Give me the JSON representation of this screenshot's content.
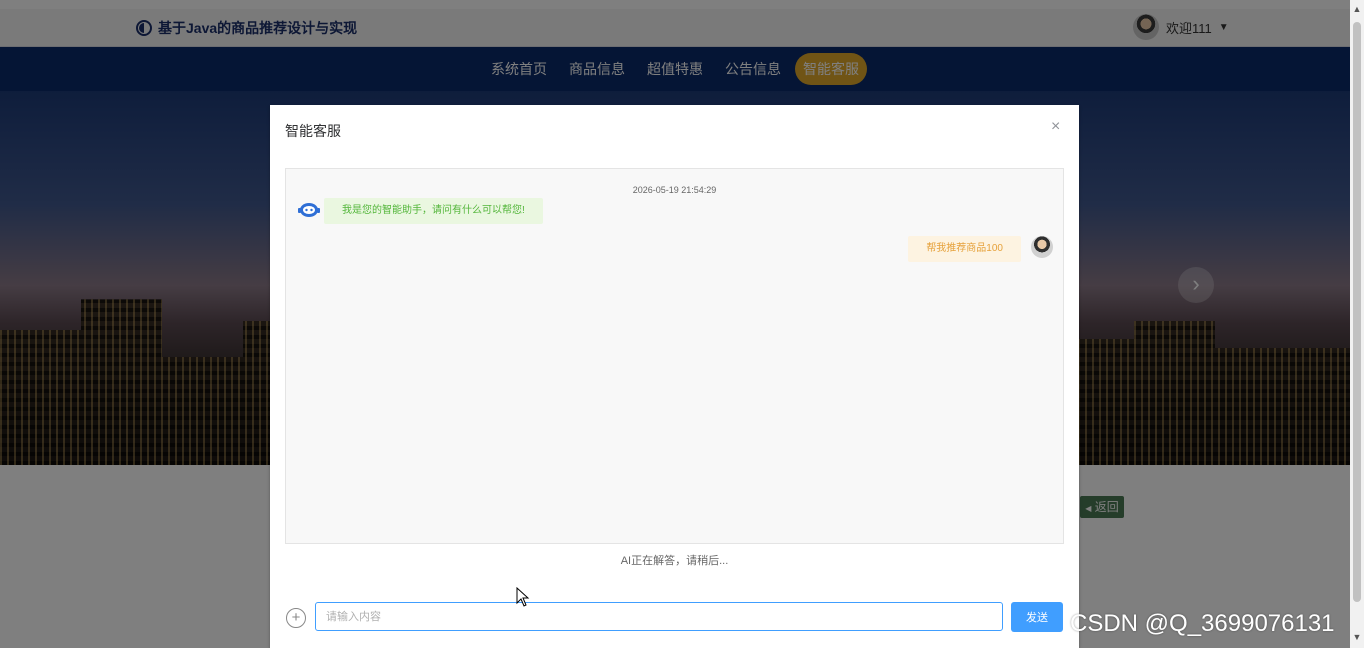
{
  "header": {
    "site_title": "基于Java的商品推荐设计与实现",
    "user_greeting": "欢迎111",
    "dropdown_caret": "▼"
  },
  "nav": {
    "items": [
      "系统首页",
      "商品信息",
      "超值特惠",
      "公告信息",
      "智能客服"
    ],
    "active_index": 4
  },
  "banner": {
    "next_arrow": "›"
  },
  "page": {
    "back_label": "返回"
  },
  "dialog": {
    "title": "智能客服",
    "close": "×",
    "timestamp": "2026-05-19 21:54:29",
    "messages": [
      {
        "from": "bot",
        "text": "我是您的智能助手，请问有什么可以帮您!"
      },
      {
        "from": "user",
        "text": "帮我推荐商品100"
      }
    ],
    "status": "AI正在解答，请稍后...",
    "attach_symbol": "+",
    "input_placeholder": "请输入内容",
    "input_value": "",
    "send_label": "发送"
  },
  "watermark": "CSDN @Q_3699076131",
  "colors": {
    "nav_bg": "#0b2a6a",
    "nav_active": "#e0a92a",
    "primary": "#409eff",
    "bot_text": "#53b63a",
    "user_text": "#e6a23c"
  }
}
